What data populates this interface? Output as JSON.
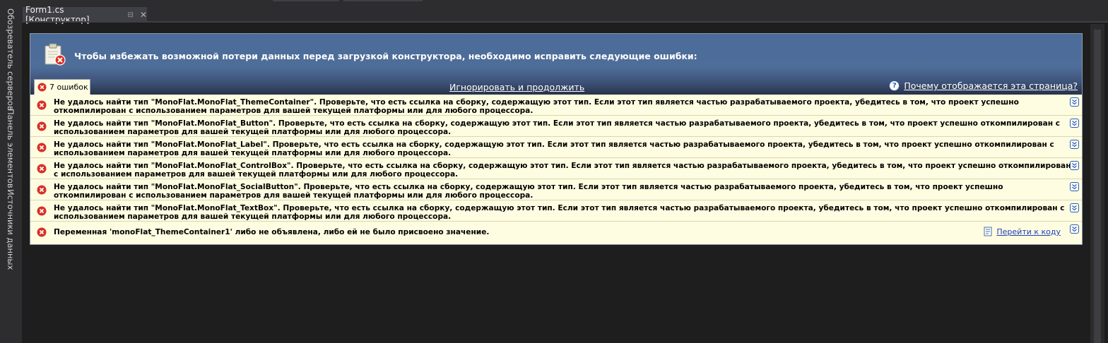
{
  "side_tabs": [
    "Обозреватель серверов",
    "Панель элементов",
    "Источники данных"
  ],
  "document_tab": {
    "title": "Form1.cs [Конструктор]"
  },
  "error_panel": {
    "header_message": "Чтобы избежать возможной потери данных перед загрузкой конструктора, необходимо исправить следующие ошибки:",
    "error_count": "7 ошибок",
    "ignore_link": "Игнорировать и продолжить",
    "help_link": "Почему отображается эта страница?",
    "goto_code_link": "Перейти к коду",
    "errors": [
      "Не удалось найти тип \"MonoFlat.MonoFlat_ThemeContainer\". Проверьте, что есть ссылка на сборку, содержащую этот тип. Если этот тип является частью разрабатываемого проекта, убедитесь в том, что проект успешно откомпилирован с использованием параметров для вашей текущей платформы или для любого процессора.",
      "Не удалось найти тип \"MonoFlat.MonoFlat_Button\". Проверьте, что есть ссылка на сборку, содержащую этот тип. Если этот тип является частью разрабатываемого проекта, убедитесь в том, что проект успешно откомпилирован с использованием параметров для вашей текущей платформы или для любого процессора.",
      "Не удалось найти тип \"MonoFlat.MonoFlat_Label\". Проверьте, что есть ссылка на сборку, содержащую этот тип. Если этот тип является частью разрабатываемого проекта, убедитесь в том, что проект успешно откомпилирован с использованием параметров для вашей текущей платформы или для любого процессора.",
      "Не удалось найти тип \"MonoFlat.MonoFlat_ControlBox\". Проверьте, что есть ссылка на сборку, содержащую этот тип. Если этот тип является частью разрабатываемого проекта, убедитесь в том, что проект успешно откомпилирован с использованием параметров для вашей текущей платформы или для любого процессора.",
      "Не удалось найти тип \"MonoFlat.MonoFlat_SocialButton\". Проверьте, что есть ссылка на сборку, содержащую этот тип. Если этот тип является частью разрабатываемого проекта, убедитесь в том, что проект успешно откомпилирован с использованием параметров для вашей текущей платформы или для любого процессора.",
      "Не удалось найти тип \"MonoFlat.MonoFlat_TextBox\". Проверьте, что есть ссылка на сборку, содержащую этот тип. Если этот тип является частью разрабатываемого проекта, убедитесь в том, что проект успешно откомпилирован с использованием параметров для вашей текущей платформы или для любого процессора.",
      "Переменная 'monoFlat_ThemeContainer1' либо не объявлена, либо ей не было присвоено значение."
    ]
  },
  "icons": [
    "error-icon",
    "clipboard-error-icon",
    "help-icon",
    "expand-icon",
    "code-file-icon",
    "pin-icon",
    "close-icon"
  ],
  "colors": {
    "ide_background": "#1e1e1e",
    "header_blue": "#4b6c99",
    "error_row_background": "#fffde1",
    "error_red": "#d93025"
  }
}
